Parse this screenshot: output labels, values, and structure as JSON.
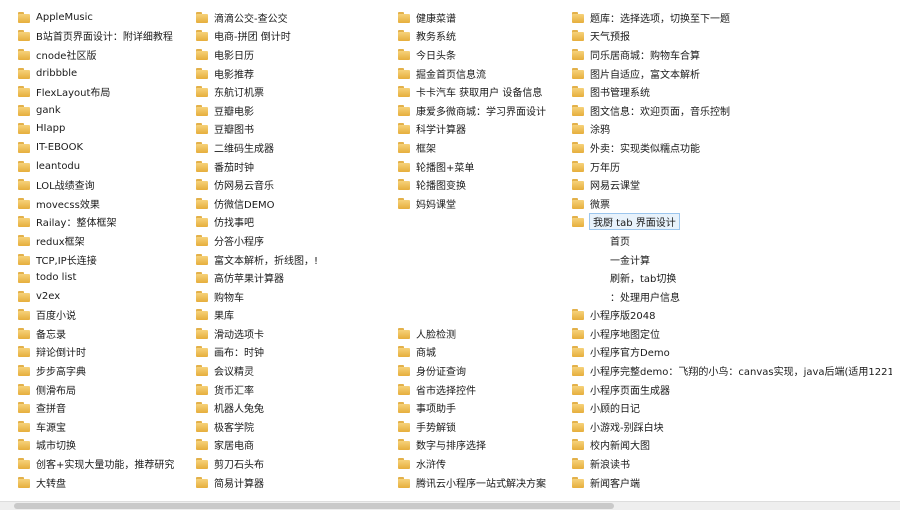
{
  "columns": [
    [
      "AppleMusic",
      "B站首页界面设计：附详细教程",
      "cnode社区版",
      "dribbble",
      "FlexLayout布局",
      "gank",
      "HIapp",
      "IT-EBOOK",
      "leantodu",
      "LOL战绩查询",
      "movecss效果",
      "Railay：整体框架",
      "redux框架",
      "TCP,IP长连接",
      "todo list",
      "v2ex",
      "百度小说",
      "备忘录",
      "辩论倒计时",
      "步步高字典",
      "侧滑布局",
      "查拼音",
      "车源宝",
      "城市切换",
      "创客+实现大量功能，推荐研究",
      "大转盘"
    ],
    [
      "滴滴公交-查公交",
      "电商-拼团 倒计时",
      "电影日历",
      "电影推荐",
      "东航订机票",
      "豆瓣电影",
      "豆瓣图书",
      "二维码生成器",
      "番茄时钟",
      "仿网易云音乐",
      "仿微信DEMO",
      "仿找事吧",
      "分答小程序",
      "富文本解析，折线图，!",
      "高仿苹果计算器",
      "购物车",
      "果库",
      "滑动选项卡",
      "画布：时钟",
      "会议精灵",
      "货币汇率",
      "机器人兔兔",
      "极客学院",
      "家居电商",
      "剪刀石头布",
      "简易计算器"
    ],
    [
      "健康菜谱",
      "教务系统",
      "今日头条",
      "掘金首页信息流",
      "卡卡汽车 获取用户 设备信息",
      "康爱多微商城：学习界面设计",
      "科学计算器",
      "框架",
      "轮播图+菜单",
      "轮播图变换",
      "妈妈课堂",
      "",
      "",
      "",
      "",
      "",
      "",
      "人脸检测",
      "商城",
      "身份证查询",
      "省市选择控件",
      "事项助手",
      "手势解锁",
      "数字与排序选择",
      "水浒传",
      "腾讯云小程序一站式解决方案"
    ],
    [
      "题库：选择选项，切换至下一题",
      "天气预报",
      "同乐居商城：购物车合算",
      "图片自适应，富文本解析",
      "图书管理系统",
      "图文信息：欢迎页面，音乐控制",
      "涂鸦",
      "外卖：实现类似糯点功能",
      "万年历",
      "网易云课堂",
      "微票",
      "我厨 tab 界面设计",
      "首页",
      "一金计算",
      "刷新，tab切换",
      "：处理用户信息",
      "小程序版2048",
      "小程序地图定位",
      "小程序官方Demo",
      "小程序完整demo：飞翔的小鸟：canvas实现，java后端(适用1221)",
      "小程序页面生成器",
      "小顾的日记",
      "小游戏-别踩白块",
      "校内新闻大图",
      "新浪读书",
      "新闻客户端"
    ]
  ],
  "col4_subitems": [
    12,
    13,
    14,
    15
  ],
  "selected_item": "我厨 tab 界面设计"
}
